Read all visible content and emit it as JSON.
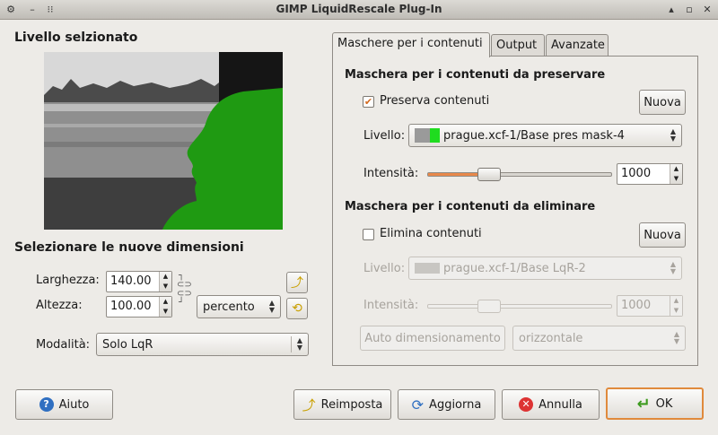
{
  "window": {
    "title": "GIMP LiquidRescale Plug-In"
  },
  "left": {
    "layer_heading": "Livello selzionato",
    "size_heading": "Selezionare le nuove dimensioni",
    "width_label": "Larghezza:",
    "width_value": "140.00",
    "height_label": "Altezza:",
    "height_value": "100.00",
    "unit_value": "percento",
    "mode_label": "Modalità:",
    "mode_value": "Solo LqR"
  },
  "tabs": [
    {
      "label": "Maschere per i contenuti"
    },
    {
      "label": "Output"
    },
    {
      "label": "Avanzate"
    }
  ],
  "preserve": {
    "heading": "Maschera per i contenuti da preservare",
    "checkbox_label": "Preserva contenuti",
    "checked": true,
    "new_label": "Nuova",
    "layer_label": "Livello:",
    "layer_value": "prague.xcf-1/Base pres mask-4",
    "intensity_label": "Intensità:",
    "intensity_value": "1000",
    "intensity_level": 0.3
  },
  "discard": {
    "heading": "Maschera per i contenuti da eliminare",
    "checkbox_label": "Elimina contenuti",
    "checked": false,
    "new_label": "Nuova",
    "layer_label": "Livello:",
    "layer_value": "prague.xcf-1/Base LqR-2",
    "intensity_label": "Intensità:",
    "intensity_value": "1000",
    "intensity_level": 0.3,
    "auto_label": "Auto dimensionamento",
    "orientation_value": "orizzontale"
  },
  "buttons": {
    "help": "Aiuto",
    "reset": "Reimposta",
    "refresh": "Aggiorna",
    "cancel": "Annulla",
    "ok": "OK"
  },
  "colors": {
    "accent": "#e08a3c",
    "mask_green": "#1f9a12"
  }
}
